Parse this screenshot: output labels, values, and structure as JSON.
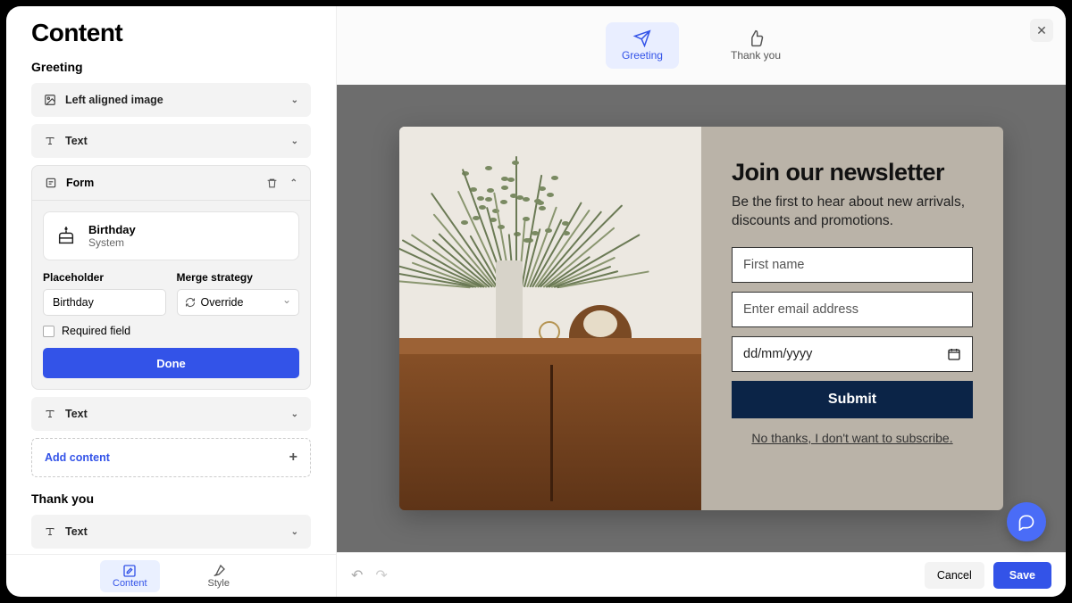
{
  "sidebar": {
    "title": "Content",
    "section_greeting": "Greeting",
    "section_thankyou": "Thank you",
    "blocks": {
      "image": "Left aligned image",
      "text": "Text",
      "form": "Form",
      "text2": "Text",
      "text3": "Text"
    },
    "field": {
      "name": "Birthday",
      "sub": "System"
    },
    "placeholder_label": "Placeholder",
    "placeholder_value": "Birthday",
    "merge_label": "Merge strategy",
    "merge_value": "Override",
    "required_label": "Required field",
    "done": "Done",
    "add_content": "Add content"
  },
  "sidebar_tabs": {
    "content": "Content",
    "style": "Style"
  },
  "top_tabs": {
    "greeting": "Greeting",
    "thankyou": "Thank you"
  },
  "preview": {
    "heading": "Join our newsletter",
    "sub": "Be the first to hear about new arrivals, discounts and promotions.",
    "first_name_ph": "First name",
    "email_ph": "Enter email address",
    "date_ph": "dd/mm/yyyy",
    "submit": "Submit",
    "decline": "No thanks, I don't want to subscribe."
  },
  "footer": {
    "cancel": "Cancel",
    "save": "Save"
  }
}
